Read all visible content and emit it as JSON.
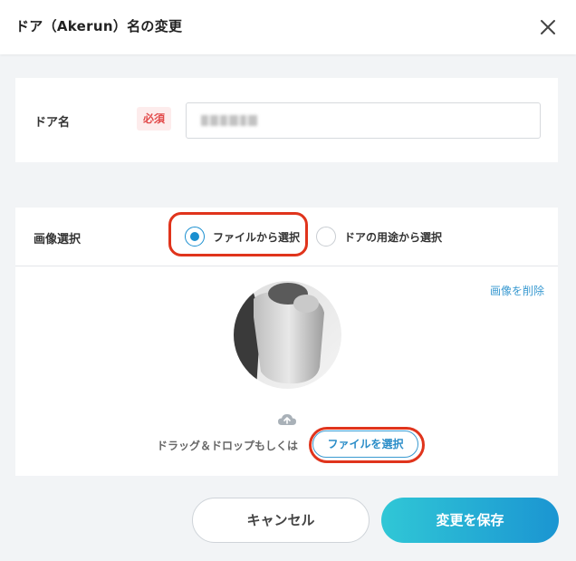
{
  "header": {
    "title": "ドア（Akerun）名の変更",
    "close_icon": "close-icon"
  },
  "door_name": {
    "label": "ドア名",
    "required_badge": "必須",
    "required_color": "#e24b4b",
    "input_value": ""
  },
  "image_select": {
    "label": "画像選択",
    "options": [
      {
        "label": "ファイルから選択",
        "selected": true
      },
      {
        "label": "ドアの用途から選択",
        "selected": false
      }
    ],
    "delete_link": "画像を削除",
    "drag_text": "ドラッグ＆ドロップもしくは",
    "file_button": "ファイルを選択",
    "upload_icon": "cloud-upload-icon"
  },
  "footer": {
    "cancel_label": "キャンセル",
    "save_label": "変更を保存"
  },
  "colors": {
    "accent": "#1a8fd0",
    "annotation": "#e0341c",
    "save_gradient_start": "#30c7d6",
    "save_gradient_end": "#1b95d2"
  }
}
